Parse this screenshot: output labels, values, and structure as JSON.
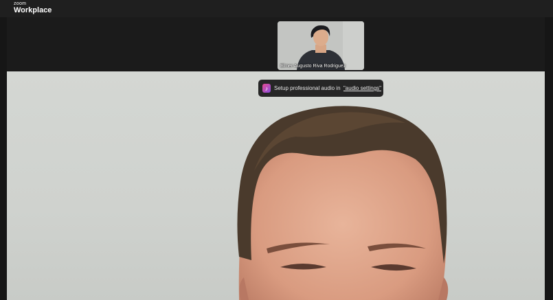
{
  "app": {
    "brand_small": "zoom",
    "brand_big": "Workplace"
  },
  "participant": {
    "name": "Elmer Augusto Riva Rodriguez"
  },
  "toast": {
    "icon": "audio-settings-icon",
    "text": "Setup professional audio in ",
    "link": "\"audio settings\""
  },
  "colors": {
    "background": "#161616",
    "titlebar": "#1f1f1f",
    "toast_bg": "#262626",
    "icon_gradient_start": "#e44c8f",
    "icon_gradient_end": "#8a4fe0"
  }
}
